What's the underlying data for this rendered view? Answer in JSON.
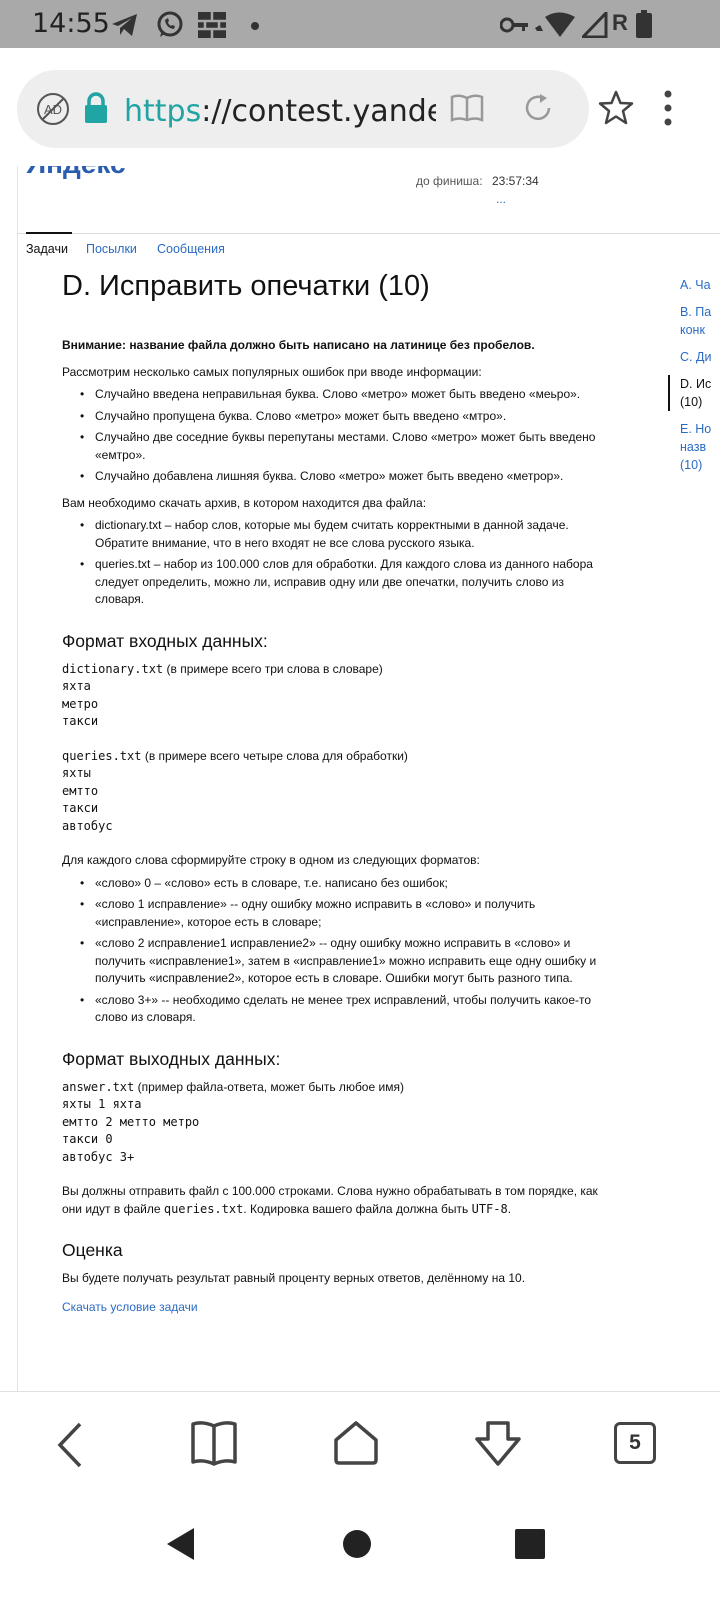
{
  "status_bar": {
    "time": "14:55",
    "left_icons": [
      "telegram-icon",
      "whatsapp-icon",
      "brick-wall-icon",
      "dot-icon"
    ],
    "right_icons": [
      "key-icon",
      "wifi-icon",
      "signal-icon",
      "battery-icon"
    ],
    "network_letter": "R"
  },
  "browser": {
    "url_scheme": "https",
    "url_rest": "://contest.yandex.ru",
    "icons": [
      "adblock-icon",
      "lock-icon",
      "reader-mode-icon",
      "reload-icon",
      "star-icon",
      "more-vert-icon"
    ]
  },
  "header": {
    "logo_partial": "Яндекс",
    "timer_label": "до финиша:",
    "timer_value": "23:57:34",
    "timer_more": "..."
  },
  "tabs": [
    {
      "label": "Задачи",
      "active": true
    },
    {
      "label": "Посылки",
      "active": false
    },
    {
      "label": "Сообщения",
      "active": false
    }
  ],
  "problem": {
    "title": "D. Исправить опечатки (10)",
    "warning": "Внимание: название файла должно быть написано на латинице без пробелов.",
    "intro": "Рассмотрим несколько самых популярных ошибок при вводе информации:",
    "errors": [
      "Случайно введена неправильная буква. Слово «метро» может быть введено «меьро».",
      "Случайно пропущена буква. Слово «метро» может быть введено «мтро».",
      "Случайно две соседние буквы перепутаны местами. Слово «метро» может быть введено «емтро».",
      "Случайно добавлена лишняя буква. Слово «метро» может быть введено «метрор»."
    ],
    "archive_intro": "Вам необходимо скачать архив, в котором находится два файла:",
    "files": [
      "dictionary.txt – набор слов, которые мы будем считать корректными в данной задаче. Обратите внимание, что в него входят не все слова русского языка.",
      "queries.txt – набор из 100.000 слов для обработки. Для каждого слова из данного набора следует определить, можно ли, исправив одну или две опечатки, получить слово из словаря."
    ],
    "input_heading": "Формат входных данных:",
    "dict_file": "dictionary.txt",
    "dict_note": " (в примере всего три слова в словаре)",
    "dict_words": [
      "яхта",
      "метро",
      "такси"
    ],
    "queries_file": "queries.txt",
    "queries_note": " (в примере всего четыре слова для обработки)",
    "query_words": [
      "яхты",
      "емтто",
      "такси",
      "автобус"
    ],
    "format_intro": "Для каждого слова сформируйте строку в одном из следующих форматов:",
    "formats": [
      "«слово» 0 – «слово» есть в словаре, т.е. написано без ошибок;",
      "«слово 1 исправление» -- одну ошибку можно исправить в «слово» и получить «исправление», которое есть в словаре;",
      "«слово 2 исправление1 исправление2» -- одну ошибку можно исправить в «слово» и получить «исправление1», затем в «исправление1» можно исправить еще одну ошибку и получить «исправление2», которое есть в словаре. Ошибки могут быть разного типа.",
      "«слово 3+» -- необходимо сделать не менее трех исправлений, чтобы получить какое-то слово из словаря."
    ],
    "output_heading": "Формат выходных данных:",
    "answer_file": "answer.txt",
    "answer_note": " (пример файла-ответа, может быть любое имя)",
    "answer_lines": [
      "яхты 1 яхта",
      "емтто 2 метто метро",
      "такси 0",
      "автобус 3+"
    ],
    "submit_pre": "Вы должны отправить файл с 100.000 строками. Слова нужно обрабатывать в том порядке, как они идут в файле ",
    "submit_file": "queries.txt",
    "submit_mid": ". Кодировка вашего файла должна быть ",
    "submit_enc": "UTF-8",
    "submit_end": ".",
    "score_heading": "Оценка",
    "score_text": "Вы будете получать результат равный проценту верных ответов, делённому на 10.",
    "download_link": "Скачать условие задачи"
  },
  "side_nav": [
    {
      "line1": "A. Ча",
      "line2": "",
      "line3": "",
      "active": false
    },
    {
      "line1": "B. Па",
      "line2": "конк",
      "line3": "",
      "active": false
    },
    {
      "line1": "C. Ди",
      "line2": "",
      "line3": "",
      "active": false
    },
    {
      "line1": "D. Ис",
      "line2": "(10)",
      "line3": "",
      "active": true
    },
    {
      "line1": "E. Но",
      "line2": "назв",
      "line3": "(10)",
      "active": false
    }
  ],
  "toolbar": {
    "tab_count": "5",
    "icons": [
      "back-icon",
      "bookmarks-icon",
      "home-icon",
      "download-icon",
      "tabs-icon"
    ]
  },
  "android_nav": {
    "icons": [
      "nav-back-icon",
      "nav-home-icon",
      "nav-recents-icon"
    ]
  },
  "colors": {
    "status_bar": "#a9a9a9",
    "link": "#2a6bc5",
    "url_scheme": "#20a4a4",
    "lock": "#20a4a4"
  }
}
